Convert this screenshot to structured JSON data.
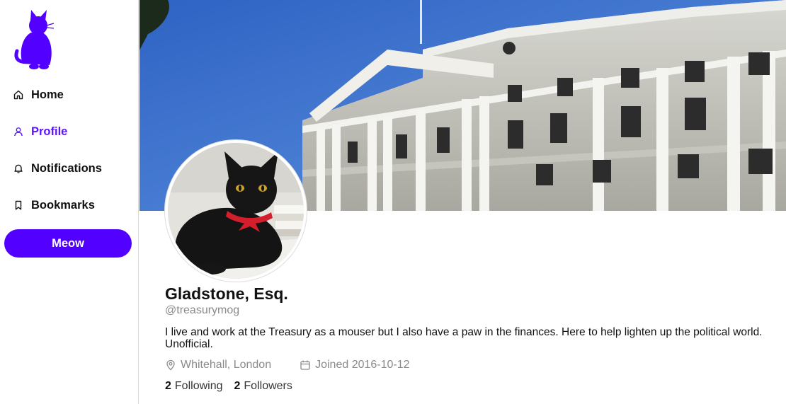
{
  "brand": {
    "accent": "#5200ff",
    "active_nav_color": "#5b14ff",
    "logo_icon": "cat-icon"
  },
  "sidebar": {
    "items": [
      {
        "label": "Home",
        "icon": "home-icon",
        "active": false
      },
      {
        "label": "Profile",
        "icon": "user-icon",
        "active": true
      },
      {
        "label": "Notifications",
        "icon": "bell-icon",
        "active": false
      },
      {
        "label": "Bookmarks",
        "icon": "bookmark-icon",
        "active": false
      }
    ],
    "meow_button": "Meow"
  },
  "profile": {
    "banner": "treasury-building-photo",
    "avatar": "black-cat-photo",
    "name": "Gladstone, Esq.",
    "handle": "@treasurymog",
    "bio": "I live and work at the Treasury as a mouser but I also have a paw in the finances. Here to help lighten up the political world. Unofficial.",
    "location": "Whitehall, London",
    "joined": "Joined 2016-10-12",
    "following_count": "2",
    "following_label": "Following",
    "followers_count": "2",
    "followers_label": "Followers"
  }
}
